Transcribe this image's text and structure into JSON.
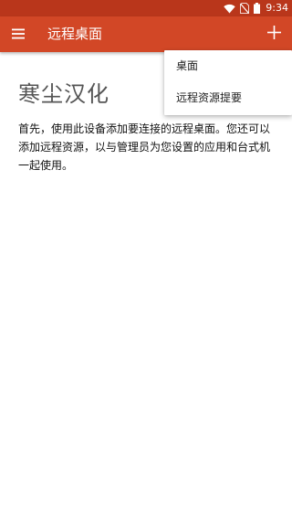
{
  "status_bar": {
    "time": "9:34",
    "icons": [
      "wifi-icon",
      "no-sim-icon",
      "battery-icon"
    ]
  },
  "app_bar": {
    "menu_icon": "hamburger-menu-icon",
    "title": "远程桌面",
    "add_icon": "plus-icon",
    "color": "#d24726"
  },
  "dropdown_menu": {
    "items": [
      {
        "label": "桌面"
      },
      {
        "label": "远程资源提要"
      }
    ]
  },
  "content": {
    "heading": "寒尘汉化",
    "intro": "首先，使用此设备添加要连接的远程桌面。您还可以添加远程资源，以与管理员为您设置的应用和台式机一起使用。"
  },
  "colors": {
    "status_bar": "#b9361b",
    "app_bar": "#d24726",
    "background": "#ffffff"
  }
}
